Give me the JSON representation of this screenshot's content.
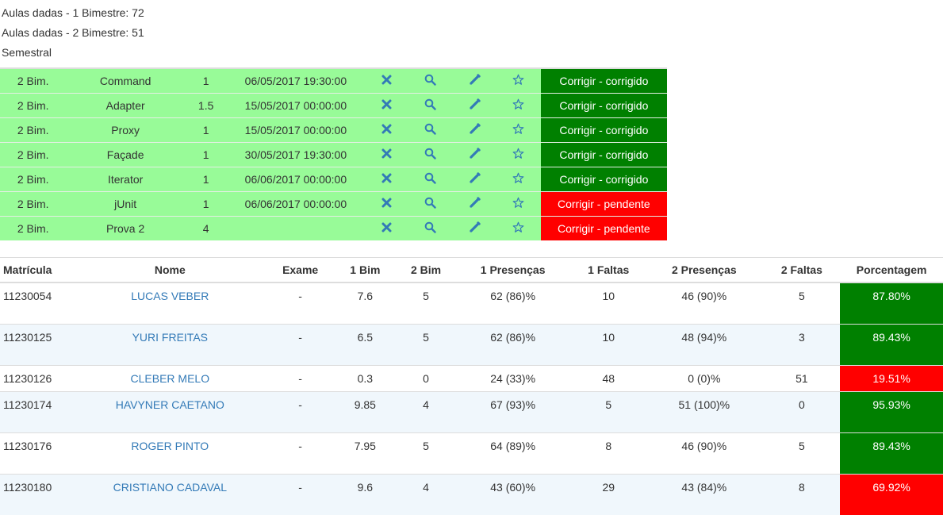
{
  "summary": {
    "aulas_bim1": "Aulas dadas - 1 Bimestre: 72",
    "aulas_bim2": "Aulas dadas - 2 Bimestre: 51",
    "period": "Semestral"
  },
  "assignments": [
    {
      "bim": "2 Bim.",
      "name": "Command",
      "weight": "1",
      "date": "06/05/2017 19:30:00",
      "status": "Corrigir - corrigido",
      "state": "corrigido"
    },
    {
      "bim": "2 Bim.",
      "name": "Adapter",
      "weight": "1.5",
      "date": "15/05/2017 00:00:00",
      "status": "Corrigir - corrigido",
      "state": "corrigido"
    },
    {
      "bim": "2 Bim.",
      "name": "Proxy",
      "weight": "1",
      "date": "15/05/2017 00:00:00",
      "status": "Corrigir - corrigido",
      "state": "corrigido"
    },
    {
      "bim": "2 Bim.",
      "name": "Façade",
      "weight": "1",
      "date": "30/05/2017 19:30:00",
      "status": "Corrigir - corrigido",
      "state": "corrigido"
    },
    {
      "bim": "2 Bim.",
      "name": "Iterator",
      "weight": "1",
      "date": "06/06/2017 00:00:00",
      "status": "Corrigir - corrigido",
      "state": "corrigido"
    },
    {
      "bim": "2 Bim.",
      "name": "jUnit",
      "weight": "1",
      "date": "06/06/2017 00:00:00",
      "status": "Corrigir - pendente",
      "state": "pendente"
    },
    {
      "bim": "2 Bim.",
      "name": "Prova 2",
      "weight": "4",
      "date": "",
      "status": "Corrigir - pendente",
      "state": "pendente"
    }
  ],
  "assignment_icons": [
    "delete-icon",
    "search-icon",
    "edit-icon",
    "star-icon"
  ],
  "students_headers": {
    "matricula": "Matrícula",
    "nome": "Nome",
    "exame": "Exame",
    "bim1": "1 Bim",
    "bim2": "2 Bim",
    "pres1": "1 Presenças",
    "faltas1": "1 Faltas",
    "pres2": "2 Presenças",
    "faltas2": "2 Faltas",
    "pct": "Porcentagem"
  },
  "students": [
    {
      "matricula": "11230054",
      "nome": "LUCAS VEBER",
      "exame": "-",
      "bim1": "7.6",
      "bim2": "5",
      "pres1": "62 (86)%",
      "faltas1": "10",
      "pres2": "46 (90)%",
      "faltas2": "5",
      "pct": "87.80%",
      "state": "good",
      "size": "tall"
    },
    {
      "matricula": "11230125",
      "nome": "YURI FREITAS",
      "exame": "-",
      "bim1": "6.5",
      "bim2": "5",
      "pres1": "62 (86)%",
      "faltas1": "10",
      "pres2": "48 (94)%",
      "faltas2": "3",
      "pct": "89.43%",
      "state": "good",
      "size": "tall"
    },
    {
      "matricula": "11230126",
      "nome": "CLEBER MELO",
      "exame": "-",
      "bim1": "0.3",
      "bim2": "0",
      "pres1": "24 (33)%",
      "faltas1": "48",
      "pres2": "0 (0)%",
      "faltas2": "51",
      "pct": "19.51%",
      "state": "bad",
      "size": "short"
    },
    {
      "matricula": "11230174",
      "nome": "HAVYNER CAETANO",
      "exame": "-",
      "bim1": "9.85",
      "bim2": "4",
      "pres1": "67 (93)%",
      "faltas1": "5",
      "pres2": "51 (100)%",
      "faltas2": "0",
      "pct": "95.93%",
      "state": "good",
      "size": "tall"
    },
    {
      "matricula": "11230176",
      "nome": "ROGER PINTO",
      "exame": "-",
      "bim1": "7.95",
      "bim2": "5",
      "pres1": "64 (89)%",
      "faltas1": "8",
      "pres2": "46 (90)%",
      "faltas2": "5",
      "pct": "89.43%",
      "state": "good",
      "size": "tall"
    },
    {
      "matricula": "11230180",
      "nome": "CRISTIANO CADAVAL",
      "exame": "-",
      "bim1": "9.6",
      "bim2": "4",
      "pres1": "43 (60)%",
      "faltas1": "29",
      "pres2": "43 (84)%",
      "faltas2": "8",
      "pct": "69.92%",
      "state": "bad",
      "size": "tall"
    }
  ],
  "colors": {
    "row_green": "#98fb98",
    "status_ok": "#008000",
    "status_pending": "#ff0000",
    "link": "#337ab7",
    "stripe": "#f0f7fc"
  }
}
